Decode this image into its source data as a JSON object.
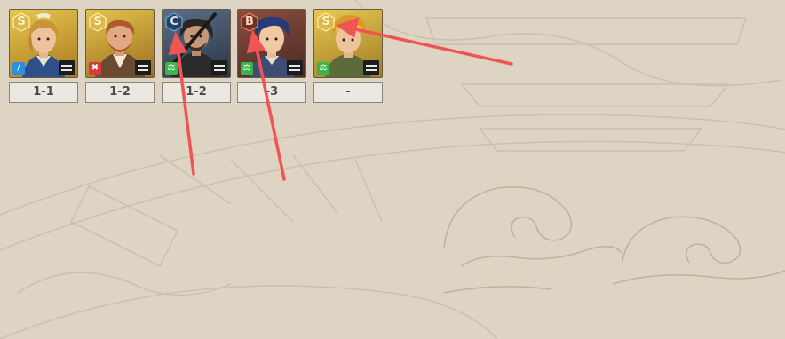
{
  "colors": {
    "annotation_arrow": "#f05454",
    "rarity_gold": "#d9b94a",
    "rarity_blue": "#5aa2d8",
    "rarity_orange": "#e17a52",
    "role_blue": "#2d8fe0",
    "role_red": "#d63a3a",
    "role_green": "#3bb54a"
  },
  "heroes": [
    {
      "rarity": "S",
      "role_icon": "sword-icon",
      "stage": "1-1"
    },
    {
      "rarity": "S",
      "role_icon": "crossed-swords-icon",
      "stage": "1-2"
    },
    {
      "rarity": "C",
      "role_icon": "scales-icon",
      "stage": "1-2"
    },
    {
      "rarity": "B",
      "role_icon": "scales-icon",
      "stage": "-3"
    },
    {
      "rarity": "S",
      "role_icon": "scales-icon",
      "stage": "-"
    }
  ]
}
